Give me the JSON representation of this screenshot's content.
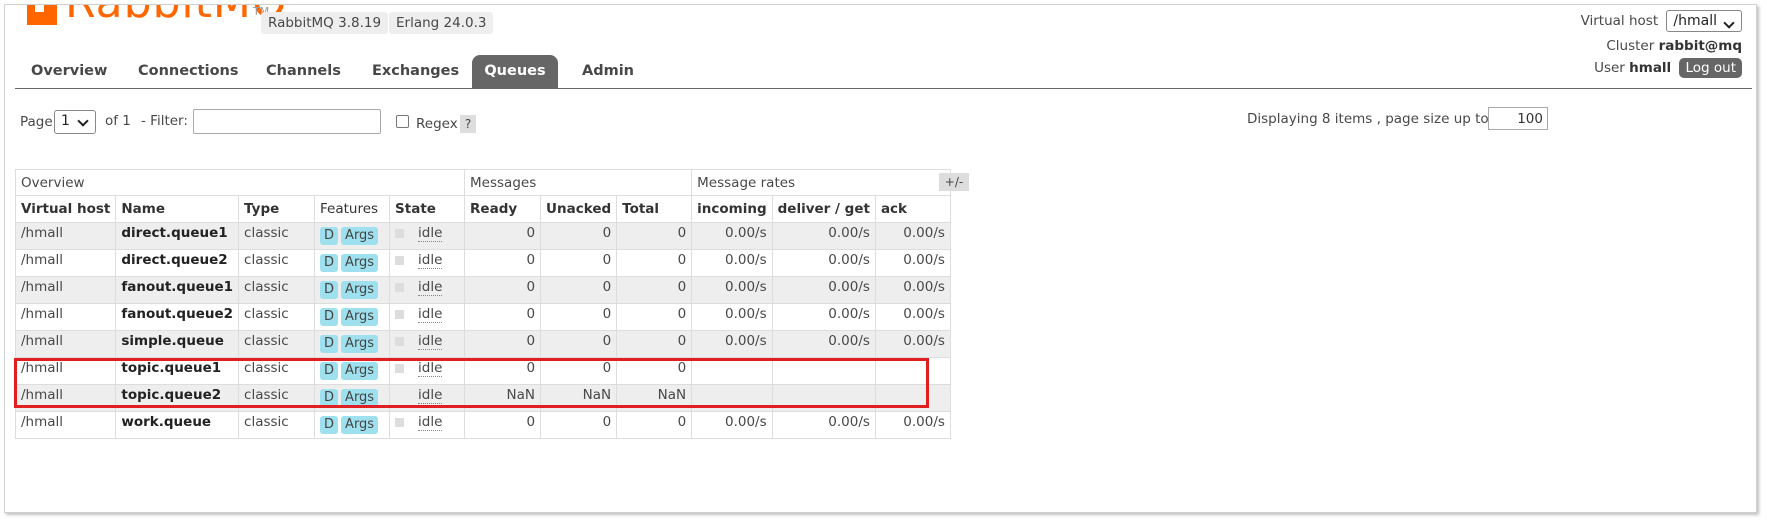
{
  "logo": {
    "word": "RabbitMQ",
    "tm": "TM"
  },
  "versions": {
    "rabbitmq": "RabbitMQ 3.8.19",
    "erlang": "Erlang 24.0.3"
  },
  "header": {
    "virtual_host_label": "Virtual host",
    "virtual_host_value": "/hmall",
    "cluster_label": "Cluster",
    "cluster_value": "rabbit@mq",
    "user_label": "User",
    "user_value": "hmall",
    "logout_label": "Log out"
  },
  "tabs": [
    "Overview",
    "Connections",
    "Channels",
    "Exchanges",
    "Queues",
    "Admin"
  ],
  "active_tab": "Queues",
  "pagination": {
    "page_label": "Page",
    "page_value": "1",
    "of_label": "of 1",
    "filter_label": "- Filter:",
    "regex_label": "Regex",
    "help": "?",
    "display_text": "Displaying 8 items , page size up to:",
    "page_size": "100"
  },
  "table": {
    "group_headers": [
      "Overview",
      "Messages",
      "Message rates"
    ],
    "toggle": "+/-",
    "columns": [
      "Virtual host",
      "Name",
      "Type",
      "Features",
      "State",
      "Ready",
      "Unacked",
      "Total",
      "incoming",
      "deliver / get",
      "ack"
    ],
    "rows": [
      {
        "vhost": "/hmall",
        "name": "direct.queue1",
        "type": "classic",
        "f1": "D",
        "f2": "Args",
        "state": "idle",
        "ready": "0",
        "unacked": "0",
        "total": "0",
        "incoming": "0.00/s",
        "deliver": "0.00/s",
        "ack": "0.00/s"
      },
      {
        "vhost": "/hmall",
        "name": "direct.queue2",
        "type": "classic",
        "f1": "D",
        "f2": "Args",
        "state": "idle",
        "ready": "0",
        "unacked": "0",
        "total": "0",
        "incoming": "0.00/s",
        "deliver": "0.00/s",
        "ack": "0.00/s"
      },
      {
        "vhost": "/hmall",
        "name": "fanout.queue1",
        "type": "classic",
        "f1": "D",
        "f2": "Args",
        "state": "idle",
        "ready": "0",
        "unacked": "0",
        "total": "0",
        "incoming": "0.00/s",
        "deliver": "0.00/s",
        "ack": "0.00/s"
      },
      {
        "vhost": "/hmall",
        "name": "fanout.queue2",
        "type": "classic",
        "f1": "D",
        "f2": "Args",
        "state": "idle",
        "ready": "0",
        "unacked": "0",
        "total": "0",
        "incoming": "0.00/s",
        "deliver": "0.00/s",
        "ack": "0.00/s"
      },
      {
        "vhost": "/hmall",
        "name": "simple.queue",
        "type": "classic",
        "f1": "D",
        "f2": "Args",
        "state": "idle",
        "ready": "0",
        "unacked": "0",
        "total": "0",
        "incoming": "0.00/s",
        "deliver": "0.00/s",
        "ack": "0.00/s"
      },
      {
        "vhost": "/hmall",
        "name": "topic.queue1",
        "type": "classic",
        "f1": "D",
        "f2": "Args",
        "state": "idle",
        "ready": "0",
        "unacked": "0",
        "total": "0",
        "incoming": "",
        "deliver": "",
        "ack": ""
      },
      {
        "vhost": "/hmall",
        "name": "topic.queue2",
        "type": "classic",
        "f1": "D",
        "f2": "Args",
        "state": "idle",
        "ready": "NaN",
        "unacked": "NaN",
        "total": "NaN",
        "incoming": "",
        "deliver": "",
        "ack": ""
      },
      {
        "vhost": "/hmall",
        "name": "work.queue",
        "type": "classic",
        "f1": "D",
        "f2": "Args",
        "state": "idle",
        "ready": "0",
        "unacked": "0",
        "total": "0",
        "incoming": "0.00/s",
        "deliver": "0.00/s",
        "ack": "0.00/s"
      }
    ]
  },
  "colors": {
    "accent": "#ff6600",
    "tab_active": "#666666",
    "badge": "#9ee0ee",
    "highlight": "#e02020"
  }
}
